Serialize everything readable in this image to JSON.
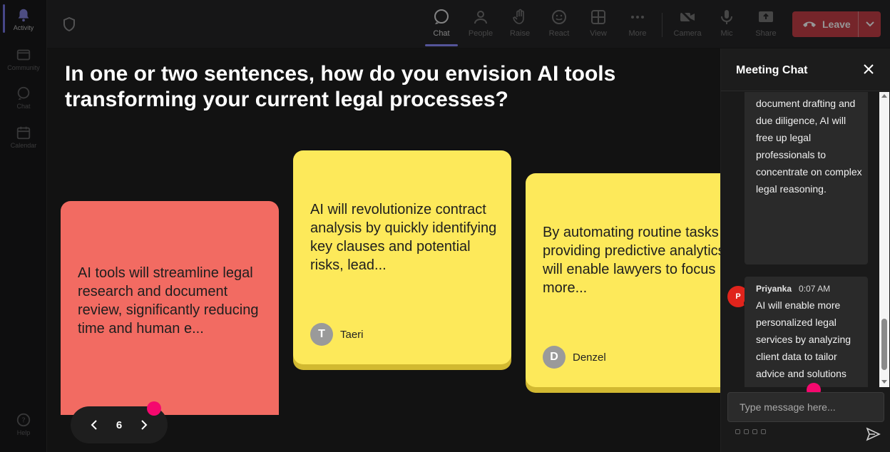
{
  "rail": {
    "items": [
      {
        "label": "Activity",
        "icon": "bell-icon"
      },
      {
        "label": "Community",
        "icon": "community-icon"
      },
      {
        "label": "Chat",
        "icon": "chat-icon"
      },
      {
        "label": "Calendar",
        "icon": "calendar-icon"
      }
    ],
    "help_label": "Help"
  },
  "toolbar": {
    "buttons": [
      {
        "label": "Chat",
        "icon": "chat-icon"
      },
      {
        "label": "People",
        "icon": "people-icon"
      },
      {
        "label": "Raise",
        "icon": "hand-icon"
      },
      {
        "label": "React",
        "icon": "smile-icon"
      },
      {
        "label": "View",
        "icon": "grid-icon"
      },
      {
        "label": "More",
        "icon": "more-icon"
      },
      {
        "label": "Camera",
        "icon": "camera-off-icon"
      },
      {
        "label": "Mic",
        "icon": "mic-icon"
      },
      {
        "label": "Share",
        "icon": "share-icon"
      }
    ],
    "leave_label": "Leave"
  },
  "stage": {
    "question": "In one or two sentences, how do you envision AI tools transforming your current legal processes?",
    "notes": [
      {
        "text": "AI tools will streamline legal research and document review, significantly reducing time and human e...",
        "author": "",
        "initial": ""
      },
      {
        "text": "AI will revolutionize contract analysis by quickly identifying key clauses and potential risks, lead...",
        "author": "Taeri",
        "initial": "T"
      },
      {
        "text": "By automating routine tasks and providing predictive analytics, AI will enable lawyers to focus more...",
        "author": "Denzel",
        "initial": "D"
      }
    ],
    "page_number": "6"
  },
  "chat": {
    "title": "Meeting Chat",
    "messages": [
      {
        "author": "",
        "time": "",
        "text": "document drafting and due diligence, AI will free up legal professionals to concentrate on complex legal reasoning."
      },
      {
        "author": "Priyanka",
        "time": "0:07 AM",
        "initial": "P",
        "text": "AI will enable more personalized legal services by analyzing client data to tailor advice and solutions more effectively."
      }
    ],
    "input_placeholder": "Type message here..."
  },
  "colors": {
    "accent": "#7f7ff0",
    "leave": "#c4323b",
    "note_red": "#f26b62",
    "note_yellow": "#fde95a",
    "pink_dot": "#f5086e",
    "avatar_red": "#e0241c"
  }
}
